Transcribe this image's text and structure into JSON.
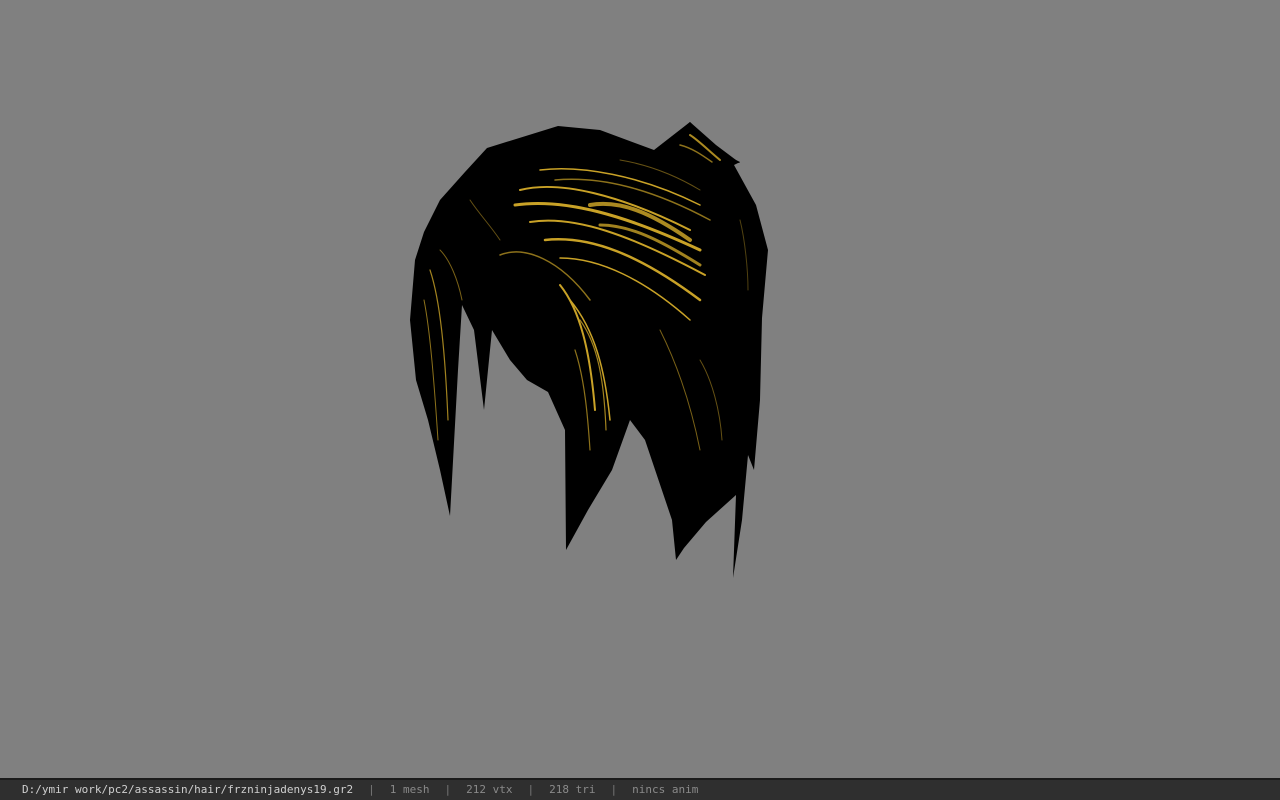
{
  "viewer": {
    "background_color": "#808080",
    "model_base_color": "#000000",
    "model_highlight_color": "#c9a227"
  },
  "status": {
    "file_path": "D:/ymir work/pc2/assassin/hair/frzninjadenys19.gr2",
    "separator": "|",
    "mesh_count": "1 mesh",
    "vertex_count": "212 vtx",
    "triangle_count": "218 tri",
    "anim_status": "nincs anim"
  }
}
